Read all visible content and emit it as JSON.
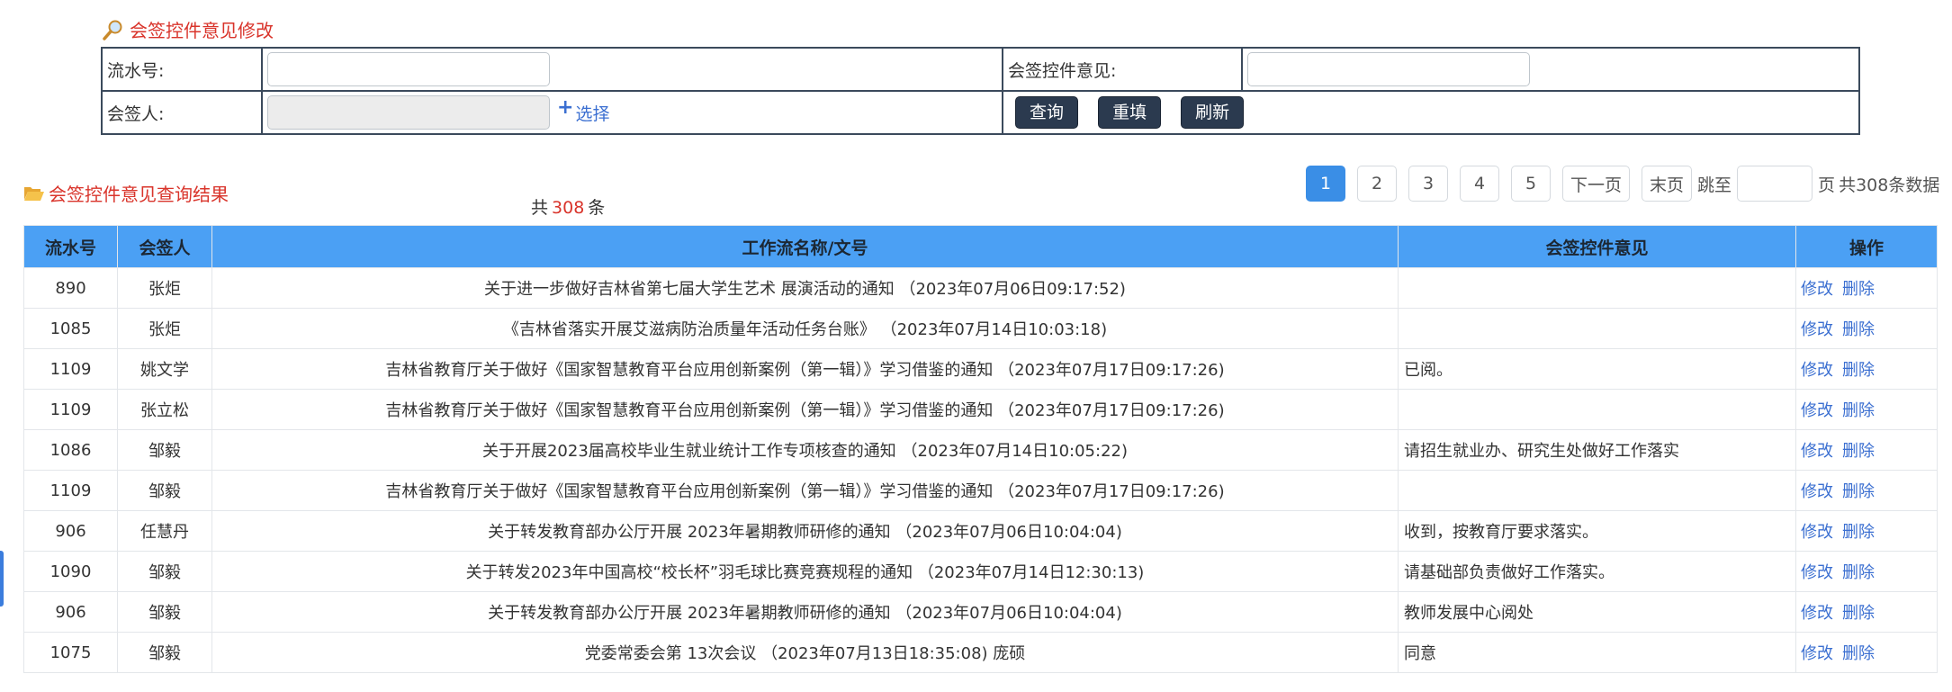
{
  "colors": {
    "accent": "#3a8ee6",
    "header_bg": "#4ba0f4",
    "title_red": "#d9342b",
    "button_bg": "#2b3a4f",
    "link": "#3b6fd1"
  },
  "form": {
    "title": "会签控件意见修改",
    "serial_label": "流水号:",
    "opinion_label": "会签控件意见:",
    "signer_label": "会签人:",
    "select_label": "选择",
    "query_button": "查询",
    "reset_button": "重填",
    "refresh_button": "刷新",
    "serial_value": "",
    "opinion_value": "",
    "signer_value": ""
  },
  "results": {
    "title": "会签控件意见查询结果",
    "count_prefix": "共",
    "count": "308",
    "count_suffix": "条"
  },
  "pager": {
    "pages": [
      "1",
      "2",
      "3",
      "4",
      "5"
    ],
    "current": "1",
    "next": "下一页",
    "last": "末页",
    "jump_label": "跳至",
    "page_unit": "页",
    "total_text": "共308条数据"
  },
  "table": {
    "headers": [
      "流水号",
      "会签人",
      "工作流名称/文号",
      "会签控件意见",
      "操作"
    ],
    "edit_label": "修改",
    "delete_label": "删除",
    "rows": [
      {
        "id": "890",
        "signer": "张炬",
        "title": "关于进一步做好吉林省第七届大学生艺术 展演活动的通知 （2023年07月06日09:17:52)",
        "opinion": ""
      },
      {
        "id": "1085",
        "signer": "张炬",
        "title": "《吉林省落实开展艾滋病防治质量年活动任务台账》 （2023年07月14日10:03:18)",
        "opinion": ""
      },
      {
        "id": "1109",
        "signer": "姚文学",
        "title": "吉林省教育厅关于做好《国家智慧教育平台应用创新案例（第一辑）》学习借鉴的通知 （2023年07月17日09:17:26)",
        "opinion": "已阅。"
      },
      {
        "id": "1109",
        "signer": "张立松",
        "title": "吉林省教育厅关于做好《国家智慧教育平台应用创新案例（第一辑）》学习借鉴的通知 （2023年07月17日09:17:26)",
        "opinion": ""
      },
      {
        "id": "1086",
        "signer": "邹毅",
        "title": "关于开展2023届高校毕业生就业统计工作专项核查的通知 （2023年07月14日10:05:22)",
        "opinion": "请招生就业办、研究生处做好工作落实"
      },
      {
        "id": "1109",
        "signer": "邹毅",
        "title": "吉林省教育厅关于做好《国家智慧教育平台应用创新案例（第一辑）》学习借鉴的通知 （2023年07月17日09:17:26)",
        "opinion": ""
      },
      {
        "id": "906",
        "signer": "任慧丹",
        "title": "关于转发教育部办公厅开展 2023年暑期教师研修的通知 （2023年07月06日10:04:04)",
        "opinion": "收到，按教育厅要求落实。"
      },
      {
        "id": "1090",
        "signer": "邹毅",
        "title": "关于转发2023年中国高校“校长杯”羽毛球比赛竞赛规程的通知 （2023年07月14日12:30:13)",
        "opinion": "请基础部负责做好工作落实。"
      },
      {
        "id": "906",
        "signer": "邹毅",
        "title": "关于转发教育部办公厅开展 2023年暑期教师研修的通知 （2023年07月06日10:04:04)",
        "opinion": "教师发展中心阅处"
      },
      {
        "id": "1075",
        "signer": "邹毅",
        "title": "党委常委会第 13次会议 （2023年07月13日18:35:08) 庞硕",
        "opinion": "同意"
      }
    ]
  }
}
